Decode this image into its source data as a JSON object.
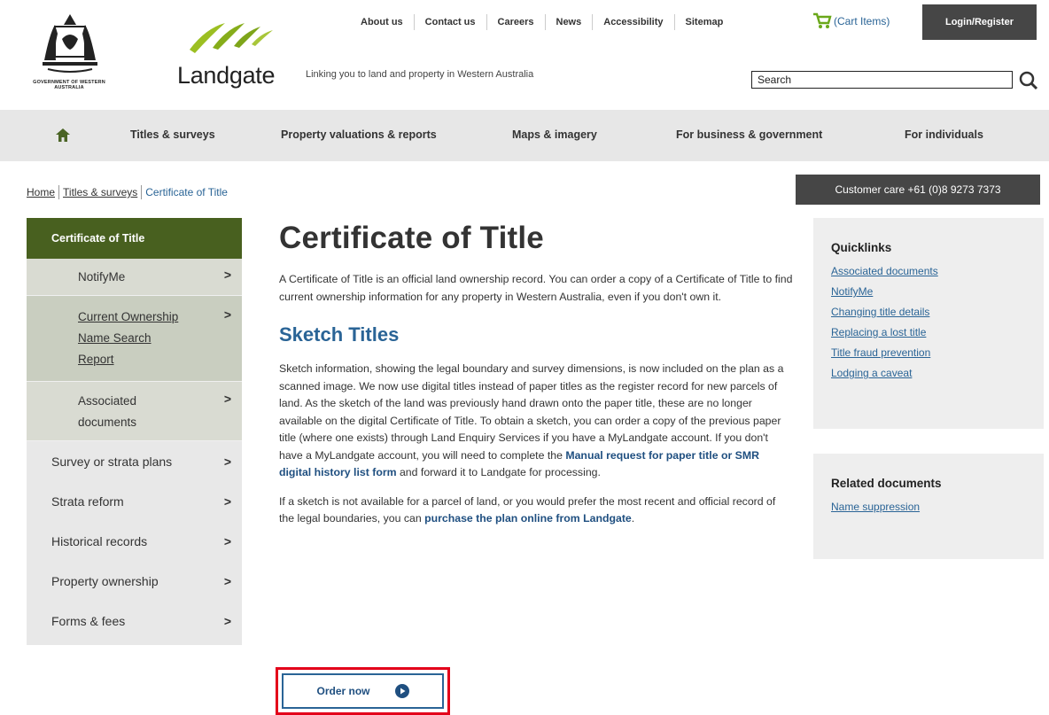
{
  "header": {
    "gov_logo_text": "GOVERNMENT OF WESTERN AUSTRALIA",
    "brand_name": "Landgate",
    "tagline": "Linking you to land and property in Western Australia",
    "top_links": [
      "About us",
      "Contact us",
      "Careers",
      "News",
      "Accessibility",
      "Sitemap"
    ],
    "cart_label": "(Cart Items)",
    "login_label": "Login/Register",
    "search_placeholder": "Search",
    "brand_color": "#8db31d"
  },
  "main_nav": {
    "home_icon": "home-icon",
    "items": [
      "Titles & surveys",
      "Property valuations & reports",
      "Maps & imagery",
      "For business & government",
      "For individuals"
    ]
  },
  "breadcrumb": {
    "items": [
      "Home",
      "Titles & surveys",
      "Certificate of Title"
    ]
  },
  "customer_care": "Customer care +61 (0)8 9273 7373",
  "sidenav": {
    "active": "Certificate of Title",
    "sub_items": [
      "NotifyMe",
      "Current Ownership Name Search Report",
      "Associated documents"
    ],
    "items": [
      "Survey or strata plans",
      "Strata reform",
      "Historical records",
      "Property ownership",
      "Forms & fees"
    ],
    "chevron": ">"
  },
  "content": {
    "title": "Certificate of Title",
    "intro": "A Certificate of Title is an official land ownership record. You can order a copy of a Certificate of Title to find current ownership information for any property in Western Australia, even if you don't own it.",
    "subtitle": "Sketch Titles",
    "para2_a": "Sketch information, showing the legal boundary and survey dimensions, is now included on the plan as a scanned image. We now use digital titles instead of paper titles as the register record for new parcels of land. As the sketch of the land was previously hand drawn onto the paper title, these are no longer available on the digital Certificate of Title. To obtain a sketch, you can order a copy of the previous paper title (where one exists) through Land Enquiry Services if you have a MyLandgate account. If you don't have a MyLandgate account, you will need to complete the ",
    "para2_link": "Manual request for paper title or SMR digital history list form",
    "para2_b": " and forward it to Landgate for processing.",
    "para3_a": "If a sketch is not available for a parcel of land, or you would prefer the most recent and official record of the legal boundaries, you can ",
    "para3_link": "purchase the plan online from Landgate",
    "para3_b": ".",
    "order_label": "Order now"
  },
  "quicklinks": {
    "title": "Quicklinks",
    "links": [
      "Associated documents",
      "NotifyMe",
      "Changing title details",
      "Replacing a lost title",
      "Title fraud prevention",
      "Lodging a caveat"
    ]
  },
  "related": {
    "title": "Related documents",
    "links": [
      "Name suppression"
    ]
  }
}
